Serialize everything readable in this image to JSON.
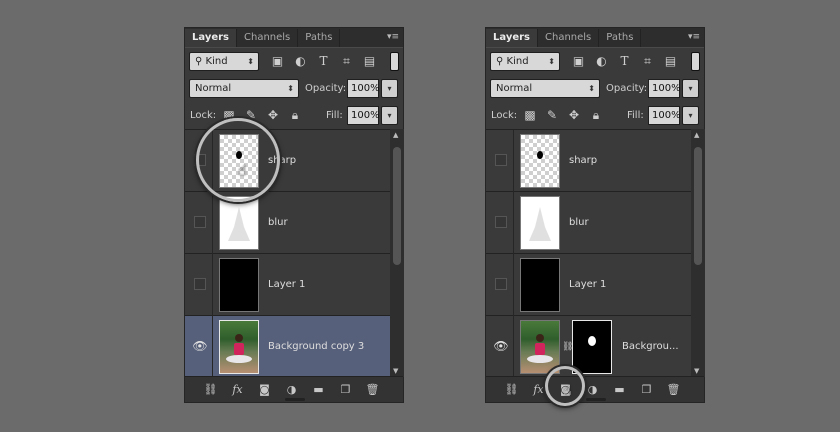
{
  "panels": [
    {
      "tabs": [
        "Layers",
        "Channels",
        "Paths"
      ],
      "filter": {
        "kind": "Kind"
      },
      "blend": {
        "mode": "Normal",
        "opacity_label": "Opacity:",
        "opacity": "100%"
      },
      "lock": {
        "label": "Lock:",
        "fill_label": "Fill:",
        "fill": "100%"
      },
      "layers": [
        {
          "name": "sharp"
        },
        {
          "name": "blur"
        },
        {
          "name": "Layer 1"
        },
        {
          "name": "Background copy 3"
        }
      ]
    },
    {
      "tabs": [
        "Layers",
        "Channels",
        "Paths"
      ],
      "filter": {
        "kind": "Kind"
      },
      "blend": {
        "mode": "Normal",
        "opacity_label": "Opacity:",
        "opacity": "100%"
      },
      "lock": {
        "label": "Lock:",
        "fill_label": "Fill:",
        "fill": "100%"
      },
      "layers": [
        {
          "name": "sharp"
        },
        {
          "name": "blur"
        },
        {
          "name": "Layer 1"
        },
        {
          "name": "Backgrou..."
        }
      ]
    }
  ],
  "footer_icons": [
    "link-icon",
    "fx-icon",
    "add-mask-icon",
    "adjustment-icon",
    "folder-icon",
    "new-layer-icon",
    "trash-icon"
  ],
  "filter_icons": [
    "image-filter-icon",
    "adjustment-filter-icon",
    "type-filter-icon",
    "shape-filter-icon",
    "smart-object-filter-icon"
  ],
  "lock_icons": [
    "lock-pixels-icon",
    "lock-brush-icon",
    "lock-position-icon",
    "lock-all-icon"
  ],
  "footer_fx_label": "fx",
  "colors": {
    "background": "#6b6b6b",
    "panel": "#3a3a3a",
    "selected_layer": "#57607a"
  }
}
